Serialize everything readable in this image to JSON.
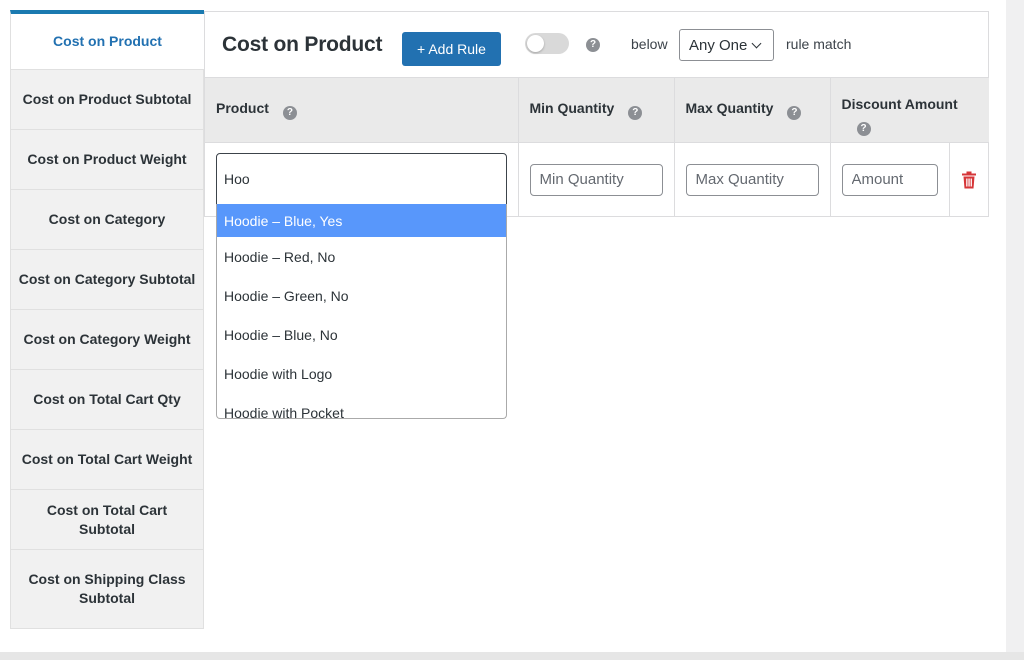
{
  "sidebar": {
    "tabs": [
      {
        "label": "Cost on Product",
        "active": true
      },
      {
        "label": "Cost on Product Subtotal"
      },
      {
        "label": "Cost on Product Weight"
      },
      {
        "label": "Cost on Category"
      },
      {
        "label": "Cost on Category Subtotal"
      },
      {
        "label": "Cost on Category Weight"
      },
      {
        "label": "Cost on Total Cart Qty"
      },
      {
        "label": "Cost on Total Cart Weight"
      },
      {
        "label": "Cost on Total Cart Subtotal"
      },
      {
        "label": "Cost on Shipping Class Subtotal"
      }
    ]
  },
  "header": {
    "title": "Cost on Product",
    "add_rule_label": "+ Add Rule",
    "toggle_on": false,
    "help_glyph": "?",
    "below_label": "below",
    "match_select_value": "Any One",
    "rule_match_label": "rule match"
  },
  "table": {
    "columns": [
      "Product",
      "Min Quantity",
      "Max Quantity",
      "Discount Amount"
    ],
    "row": {
      "product_search_value": "Hoo",
      "min_placeholder": "Min Quantity",
      "max_placeholder": "Max Quantity",
      "amount_placeholder": "Amount"
    }
  },
  "dropdown": {
    "options": [
      {
        "label": "Hoodie – Blue, Yes",
        "highlighted": true
      },
      {
        "label": "Hoodie – Red, No"
      },
      {
        "label": "Hoodie – Green, No"
      },
      {
        "label": "Hoodie – Blue, No"
      },
      {
        "label": "Hoodie with Logo"
      },
      {
        "label": "Hoodie with Pocket"
      }
    ]
  },
  "colors": {
    "accent": "#2271b1",
    "active_tab_border": "#1a7ab0",
    "highlight": "#5897fb",
    "delete": "#d63638"
  }
}
